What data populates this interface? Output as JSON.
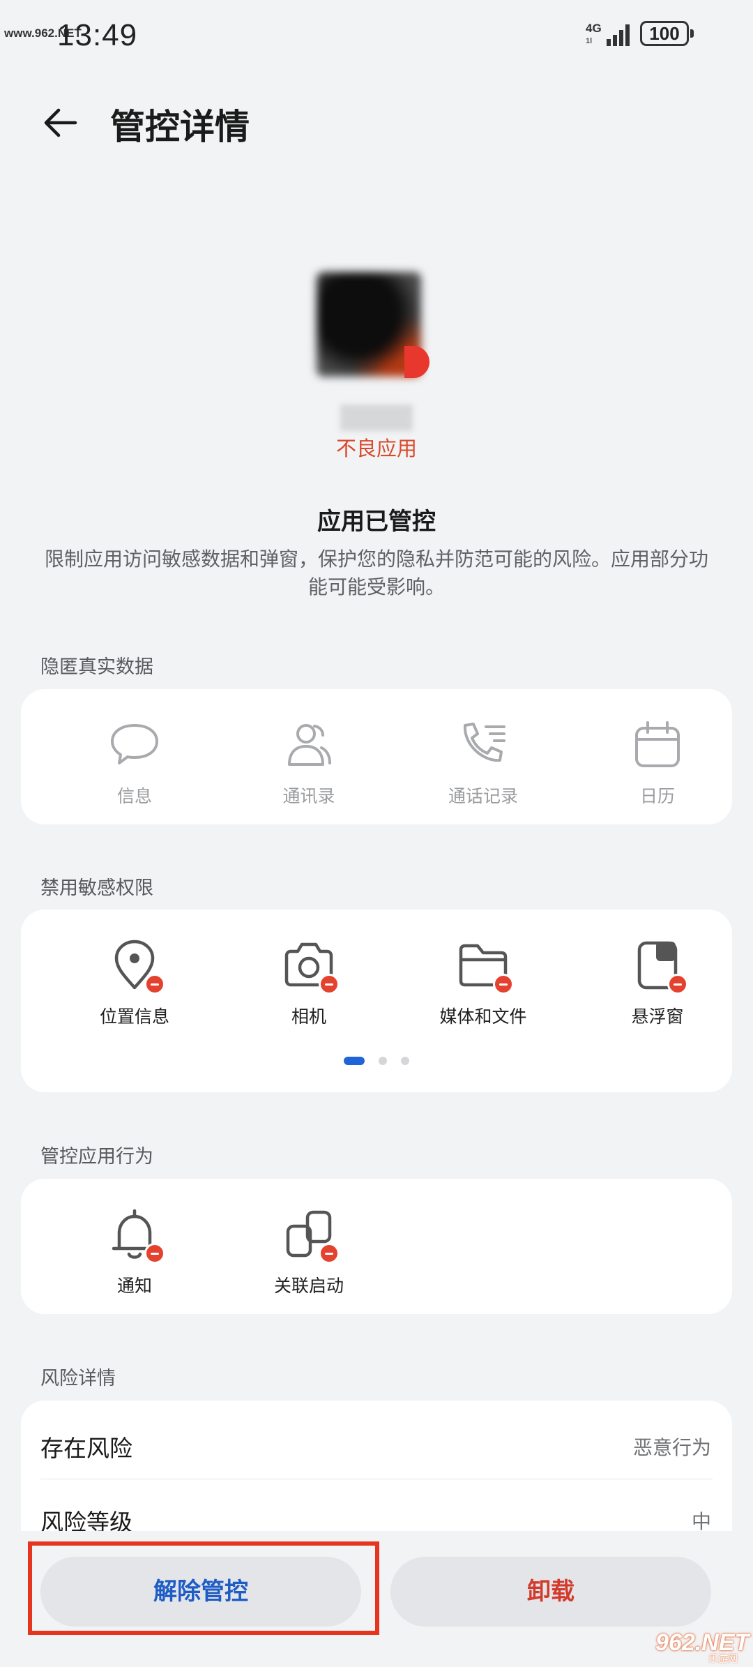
{
  "status_bar": {
    "time": "13:49",
    "network": "4G",
    "network_sub": "1l",
    "battery": "100",
    "watermark": "www.962.NET"
  },
  "header": {
    "back_icon": "arrow-left-icon",
    "title": "管控详情"
  },
  "app": {
    "tag": "不良应用",
    "managed_title": "应用已管控",
    "description": "限制应用访问敏感数据和弹窗，保护您的隐私并防范可能的风险。应用部分功能可能受影响。"
  },
  "hidden_data": {
    "title": "隐匿真实数据",
    "items": [
      {
        "label": "信息",
        "icon": "message-icon"
      },
      {
        "label": "通讯录",
        "icon": "contacts-icon"
      },
      {
        "label": "通话记录",
        "icon": "call-log-icon"
      },
      {
        "label": "日历",
        "icon": "calendar-icon"
      }
    ]
  },
  "permissions": {
    "title": "禁用敏感权限",
    "items": [
      {
        "label": "位置信息",
        "icon": "location-icon"
      },
      {
        "label": "相机",
        "icon": "camera-icon"
      },
      {
        "label": "媒体和文件",
        "icon": "folder-icon"
      },
      {
        "label": "悬浮窗",
        "icon": "floating-window-icon"
      }
    ],
    "page_count": 3,
    "current_page": 1
  },
  "behaviors": {
    "title": "管控应用行为",
    "items": [
      {
        "label": "通知",
        "icon": "bell-icon"
      },
      {
        "label": "关联启动",
        "icon": "linked-launch-icon"
      }
    ]
  },
  "risk": {
    "title": "风险详情",
    "rows": [
      {
        "label": "存在风险",
        "value": "恶意行为"
      },
      {
        "label": "风险等级",
        "value": "中"
      }
    ]
  },
  "actions": {
    "release_label": "解除管控",
    "uninstall_label": "卸载"
  },
  "watermark_bottom": {
    "main": "962.NET",
    "sub": "乐游网"
  },
  "colors": {
    "accent": "#1f64d8",
    "danger": "#e5412f",
    "highlight": "#e5351f",
    "background": "#f1f3f5"
  }
}
